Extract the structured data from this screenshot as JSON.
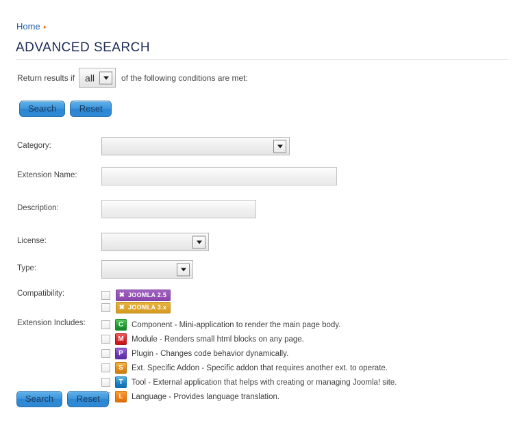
{
  "breadcrumb": {
    "home_label": "Home",
    "separator": "▸"
  },
  "page": {
    "title": "ADVANCED SEARCH"
  },
  "conditions": {
    "prefix_label": "Return results if",
    "match_value": "all",
    "suffix_label": "of the following conditions are met:"
  },
  "buttons": {
    "search_label": "Search",
    "reset_label": "Reset"
  },
  "fields": {
    "category": {
      "label": "Category:",
      "value": ""
    },
    "extension_name": {
      "label": "Extension Name:",
      "value": "",
      "placeholder": ""
    },
    "description": {
      "label": "Description:",
      "value": "",
      "placeholder": ""
    },
    "license": {
      "label": "License:",
      "value": ""
    },
    "type": {
      "label": "Type:",
      "value": ""
    },
    "compatibility": {
      "label": "Compatibility:"
    },
    "extension_includes": {
      "label": "Extension Includes:"
    }
  },
  "compatibility_options": [
    {
      "id": "joomla25",
      "label": "JOOMLA 2.5",
      "logo": "✖",
      "color": "#8c46ac",
      "checked": false
    },
    {
      "id": "joomla3x",
      "label": "JOOMLA 3.x",
      "logo": "✖",
      "color": "#d39a20",
      "checked": false
    }
  ],
  "extension_includes_options": [
    {
      "id": "component",
      "icon_letter": "C",
      "icon_color": "#1f9b31",
      "text": "Component - Mini-application to render the main page body.",
      "checked": false
    },
    {
      "id": "module",
      "icon_letter": "M",
      "icon_color": "#d81f26",
      "text": "Module - Renders small html blocks on any page.",
      "checked": false
    },
    {
      "id": "plugin",
      "icon_letter": "P",
      "icon_color": "#6b3ab5",
      "text": "Plugin - Changes code behavior dynamically.",
      "checked": false
    },
    {
      "id": "addon",
      "icon_letter": "S",
      "icon_color": "#e08c15",
      "text": "Ext. Specific Addon - Specific addon that requires another ext. to operate.",
      "checked": false
    },
    {
      "id": "tool",
      "icon_letter": "T",
      "icon_color": "#1b7fc4",
      "text": "Tool - External application that helps with creating or managing Joomla! site.",
      "checked": false
    },
    {
      "id": "language",
      "icon_letter": "L",
      "icon_color": "#ef7c11",
      "text": "Language - Provides language translation.",
      "checked": false
    }
  ]
}
